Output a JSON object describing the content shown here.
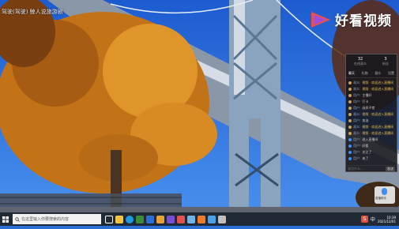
{
  "video": {
    "title": "驾驶(驾驶) 鲸人说旅游剧"
  },
  "watermark": {
    "brand": "好看视频"
  },
  "panel": {
    "stats": [
      {
        "num": "32",
        "label": "在线观众"
      },
      {
        "num": "3",
        "label": "粉丝"
      }
    ],
    "tabs": [
      "聊天",
      "礼物",
      "观众",
      "设置"
    ],
    "messages": [
      {
        "name": "观众:",
        "text": "视频 · 欢迎进入直播间",
        "highlight": true
      },
      {
        "name": "观众:",
        "text": "视频 · 欢迎进入直播间",
        "highlight": true
      },
      {
        "name": "用户:",
        "text": "主播好",
        "highlight": false
      },
      {
        "name": "用户:",
        "text": "打卡",
        "highlight": false
      },
      {
        "name": "用户:",
        "text": "画质不错",
        "highlight": false
      },
      {
        "name": "观众:",
        "text": "视频 · 欢迎进入直播间",
        "highlight": true
      },
      {
        "name": "用户:",
        "text": "加油",
        "highlight": false
      },
      {
        "name": "观众:",
        "text": "视频 · 欢迎进入直播间",
        "highlight": true
      },
      {
        "name": "观众:",
        "text": "视频 · 欢迎进入直播间",
        "highlight": true
      },
      {
        "name": "用户:",
        "text": "进入直播间",
        "highlight": false
      },
      {
        "name": "用户:",
        "text": "好看",
        "highlight": false
      },
      {
        "name": "用户:",
        "text": "关注了",
        "highlight": false
      },
      {
        "name": "用户:",
        "text": "来了",
        "highlight": false
      }
    ],
    "input_placeholder": "说点什么...",
    "send_label": "发送"
  },
  "assistant": {
    "label": "直播助手"
  },
  "taskbar": {
    "search_placeholder": "在这里输入你要搜索的内容",
    "ime": "S",
    "lang": "中",
    "time": "10:39",
    "date": "2021/12/01"
  }
}
